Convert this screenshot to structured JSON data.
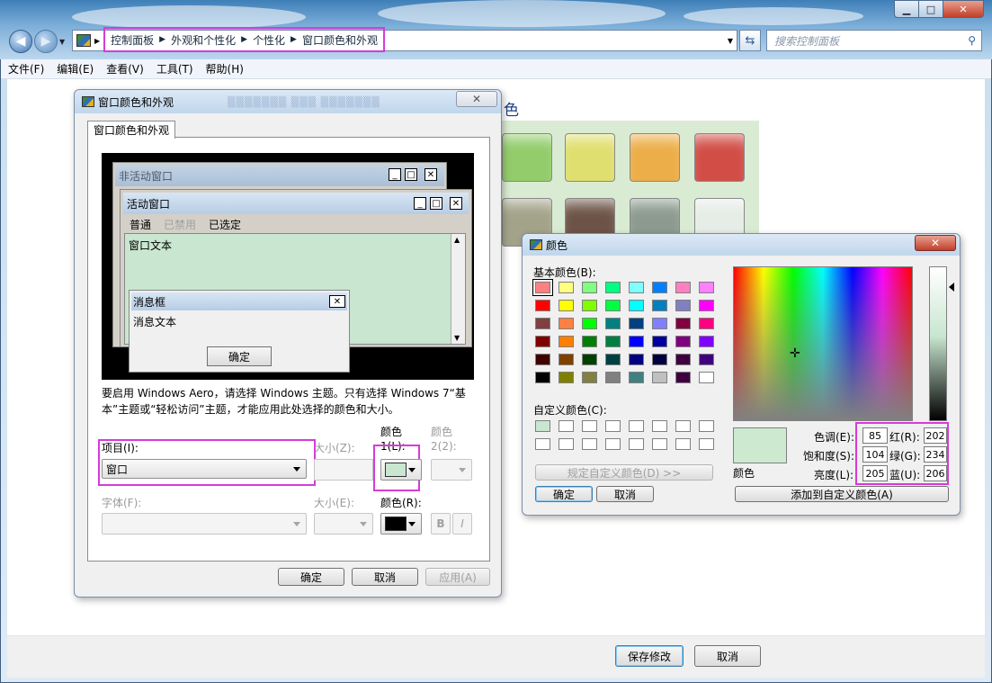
{
  "window": {
    "controls": {
      "minimize": "▁",
      "maximize": "□",
      "close": "✕"
    },
    "address": [
      "控制面板",
      "外观和个性化",
      "个性化",
      "窗口颜色和外观"
    ],
    "search_placeholder": "搜索控制面板",
    "menu": [
      "文件(F)",
      "编辑(E)",
      "查看(V)",
      "工具(T)",
      "帮助(H)"
    ],
    "footer": {
      "save": "保存修改",
      "cancel": "取消"
    }
  },
  "background_page": {
    "title_tail": "色",
    "tile_colors": [
      "#93cc6b",
      "#dfdf6f",
      "#ecae48",
      "#d14d46",
      "#a3a38a",
      "#6d5347",
      "#8c9a8f",
      "#e6ece6"
    ]
  },
  "appearance_dialog": {
    "title": "窗口颜色和外观",
    "close": "✕",
    "tab": "窗口颜色和外观",
    "preview": {
      "inactive_title": "非活动窗口",
      "active_title": "活动窗口",
      "menu_normal": "普通",
      "menu_disabled": "已禁用",
      "menu_selected": "已选定",
      "window_text": "窗口文本",
      "msgbox_title": "消息框",
      "msgbox_text": "消息文本",
      "msgbox_ok": "确定"
    },
    "note": "要启用 Windows Aero，请选择 Windows 主题。只有选择 Windows 7“基本”主题或“轻松访问”主题，才能应用此处选择的颜色和大小。",
    "item_label": "项目(I):",
    "item_value": "窗口",
    "size_label": "大小(Z):",
    "color1_label_a": "颜色",
    "color1_label_b": "1(L):",
    "color2_label_a": "颜色",
    "color2_label_b": "2(2):",
    "color1_value": "#c8e6d0",
    "font_label": "字体(F):",
    "font_size_label": "大小(E):",
    "font_color_label": "颜色(R):",
    "font_color_value": "#000000",
    "bold": "B",
    "italic": "I",
    "ok": "确定",
    "cancel": "取消",
    "apply": "应用(A)"
  },
  "color_dialog": {
    "title": "颜色",
    "close": "✕",
    "basic_label": "基本颜色(B):",
    "basic_colors": [
      "#ff8080",
      "#ffff80",
      "#80ff80",
      "#00ff80",
      "#80ffff",
      "#0080ff",
      "#ff80c0",
      "#ff80ff",
      "#ff0000",
      "#ffff00",
      "#80ff00",
      "#00ff40",
      "#00ffff",
      "#0080c0",
      "#8080c0",
      "#ff00ff",
      "#804040",
      "#ff8040",
      "#00ff00",
      "#008080",
      "#004080",
      "#8080ff",
      "#800040",
      "#ff0080",
      "#800000",
      "#ff8000",
      "#008000",
      "#008040",
      "#0000ff",
      "#0000a0",
      "#800080",
      "#8000ff",
      "#400000",
      "#804000",
      "#004000",
      "#004040",
      "#000080",
      "#000040",
      "#400040",
      "#400080",
      "#000000",
      "#808000",
      "#808040",
      "#808080",
      "#408080",
      "#c0c0c0",
      "#400040",
      "#ffffff"
    ],
    "custom_label": "自定义颜色(C):",
    "custom_colors": [
      "#c8e6d0",
      "#ffffff",
      "#ffffff",
      "#ffffff",
      "#ffffff",
      "#ffffff",
      "#ffffff",
      "#ffffff",
      "#ffffff",
      "#ffffff",
      "#ffffff",
      "#ffffff",
      "#ffffff",
      "#ffffff",
      "#ffffff",
      "#ffffff"
    ],
    "define_custom": "规定自定义颜色(D) >>",
    "ok": "确定",
    "cancel": "取消",
    "preview_label": "颜色",
    "preview_color": "#cdead0",
    "fields": {
      "hue_label": "色调(E):",
      "hue": "85",
      "sat_label": "饱和度(S):",
      "sat": "104",
      "lum_label": "亮度(L):",
      "lum": "205",
      "red_label": "红(R):",
      "red": "202",
      "green_label": "绿(G):",
      "green": "234",
      "blue_label": "蓝(U):",
      "blue": "206"
    },
    "add_custom": "添加到自定义颜色(A)"
  }
}
